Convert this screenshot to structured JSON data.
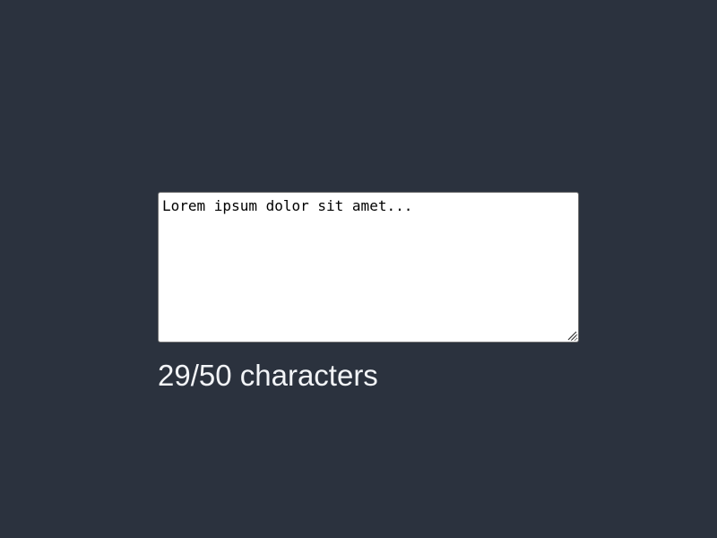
{
  "editor": {
    "value": "Lorem ipsum dolor sit amet...",
    "max_length": 50
  },
  "counter": {
    "text": "29/50 characters"
  },
  "colors": {
    "background": "#2b323e",
    "textarea_background": "#ffffff",
    "counter_text": "#f2f4f7"
  }
}
